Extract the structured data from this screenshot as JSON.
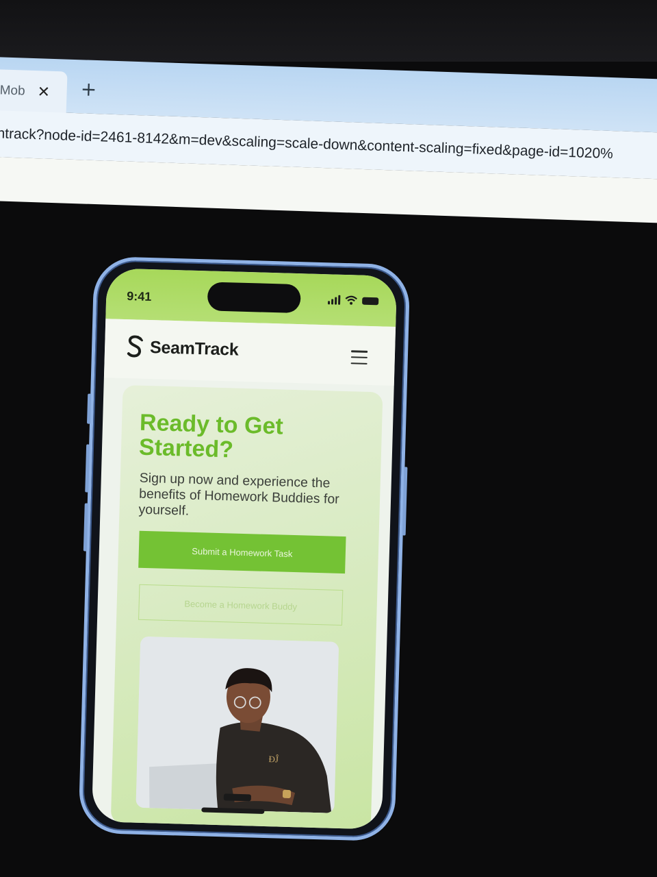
{
  "browser": {
    "tab_title": "Mob",
    "tab_close_icon": "close-icon",
    "new_tab_icon": "plus-icon",
    "new_tab_glyph": "+",
    "url": "ntrack?node-id=2461-8142&m=dev&scaling=scale-down&content-scaling=fixed&page-id=1020%"
  },
  "phone": {
    "status": {
      "time": "9:41",
      "icons": [
        "signal-icon",
        "wifi-icon",
        "battery-icon"
      ]
    },
    "header": {
      "brand": "SeamTrack",
      "logo_icon": "seamtrack-logo-icon",
      "menu_icon": "hamburger-menu-icon"
    },
    "hero": {
      "title": "Ready to Get Started?",
      "subtitle": "Sign up now and experience the benefits of Homework Buddies for yourself.",
      "primary_cta": "Submit a Homework Task",
      "secondary_cta": "Become a Homework Buddy",
      "image_icon": "person-with-laptop-photo"
    }
  },
  "colors": {
    "accent_green": "#74c234",
    "title_green": "#6bbb2a",
    "status_bar_green": "#a7d85a",
    "phone_frame_blue": "#8fb2e6"
  }
}
